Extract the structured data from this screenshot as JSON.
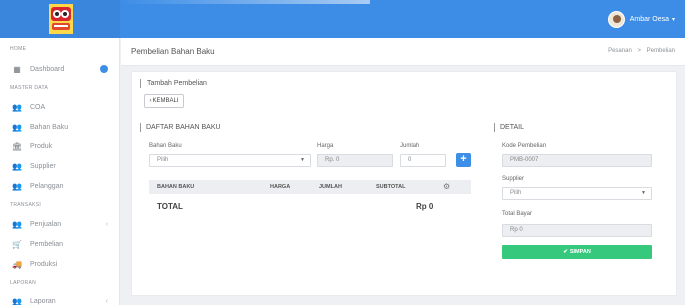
{
  "header": {
    "user_name": "Ambar Oesa",
    "colors": {
      "bar": "#3d8de6"
    }
  },
  "sidebar": {
    "sections": [
      {
        "label": "HOME"
      },
      {
        "label": "MASTER DATA"
      },
      {
        "label": "TRANSAKSI"
      },
      {
        "label": "LAPORAN"
      }
    ],
    "items": [
      {
        "label": "Dashboard",
        "icon": "dashboard-icon"
      },
      {
        "label": "COA",
        "icon": "users-icon"
      },
      {
        "label": "Bahan Baku",
        "icon": "users-icon"
      },
      {
        "label": "Produk",
        "icon": "bank-icon"
      },
      {
        "label": "Supplier",
        "icon": "users-icon"
      },
      {
        "label": "Pelanggan",
        "icon": "users-icon"
      },
      {
        "label": "Penjualan",
        "icon": "users-icon"
      },
      {
        "label": "Pembelian",
        "icon": "cart-icon"
      },
      {
        "label": "Produksi",
        "icon": "truck-icon"
      },
      {
        "label": "Laporan",
        "icon": "users-icon"
      }
    ]
  },
  "page": {
    "title": "Pembelian Bahan Baku",
    "breadcrumb": {
      "parent": "Pesanan",
      "separator": ">",
      "current": "Pembelian"
    }
  },
  "card": {
    "title": "Tambah Pembelian",
    "back_label": "KEMBALI"
  },
  "daftar": {
    "title": "DAFTAR BAHAN BAKU",
    "bahan_label": "Bahan Baku",
    "bahan_value": "Pilih",
    "harga_label": "Harga",
    "harga_placeholder": "Rp. 0",
    "jumlah_label": "Jumlah",
    "jumlah_placeholder": "0",
    "table_headers": [
      "BAHAN BAKU",
      "HARGA",
      "JUMLAH",
      "SUBTOTAL"
    ],
    "total_label": "TOTAL",
    "total_value": "Rp 0"
  },
  "detail": {
    "title": "DETAIL",
    "kode_label": "Kode Pembelian",
    "kode_value": "PMB-0007",
    "supplier_label": "Supplier",
    "supplier_value": "Pilih",
    "total_bayar_label": "Total Bayar",
    "total_bayar_value": "Rp 0",
    "save_label": "SIMPAN",
    "colors": {
      "save": "#36c97e"
    }
  }
}
